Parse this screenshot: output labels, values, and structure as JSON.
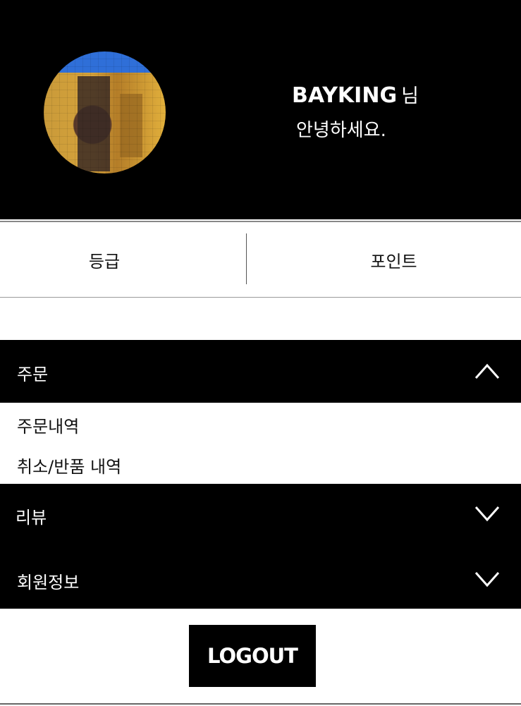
{
  "profile": {
    "username": "BAYKING",
    "suffix": "님",
    "greeting": "안녕하세요."
  },
  "stats": {
    "grade_label": "등급",
    "points_label": "포인트"
  },
  "menu": {
    "order": {
      "label": "주문",
      "expanded": true,
      "icon": "chevron-up-icon"
    },
    "order_items": [
      "주문내역",
      "취소/반품 내역"
    ],
    "review": {
      "label": "리뷰",
      "expanded": false,
      "icon": "chevron-down-icon"
    },
    "member": {
      "label": "회원정보",
      "expanded": false,
      "icon": "chevron-down-icon"
    }
  },
  "logout": {
    "label": "LOGOUT"
  },
  "colors": {
    "header_bg": "#000000",
    "text_on_dark": "#ffffff",
    "page_bg": "#ffffff"
  }
}
